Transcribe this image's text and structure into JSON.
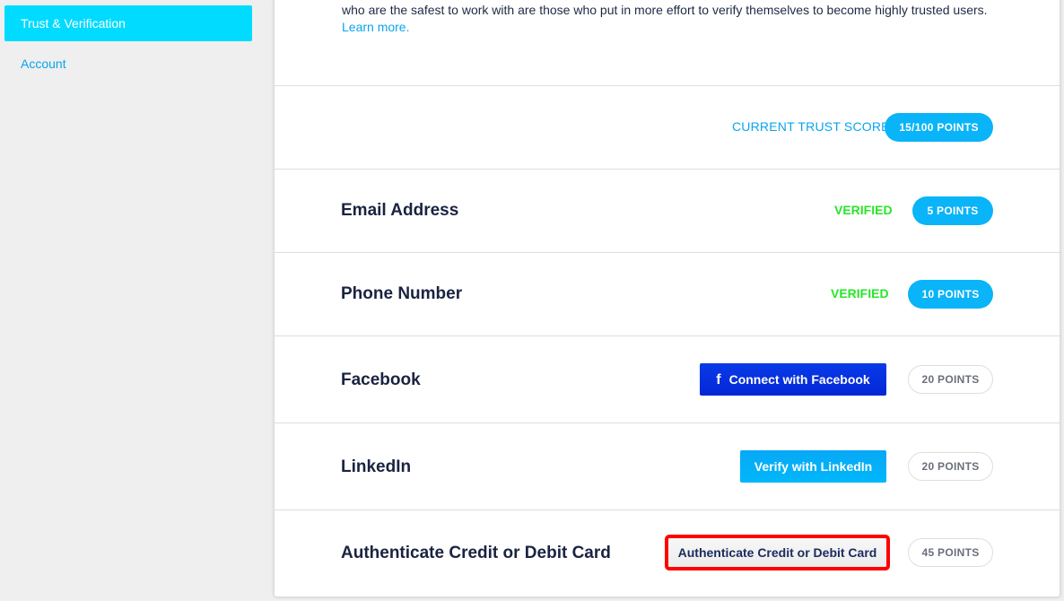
{
  "sidebar": {
    "items": [
      {
        "label": "Trust & Verification",
        "active": true
      },
      {
        "label": "Account",
        "active": false
      }
    ]
  },
  "intro": {
    "text": "who are the safest to work with are those who put in more effort to verify themselves to become highly trusted users.",
    "learn_more": "Learn more."
  },
  "trust_score": {
    "label": "CURRENT TRUST SCORE",
    "value": "15/100 POINTS"
  },
  "verifications": [
    {
      "title": "Email Address",
      "status": "VERIFIED",
      "points": "5 POINTS"
    },
    {
      "title": "Phone Number",
      "status": "VERIFIED",
      "points": "10 POINTS"
    },
    {
      "title": "Facebook",
      "action": "Connect with Facebook",
      "points": "20 POINTS"
    },
    {
      "title": "LinkedIn",
      "action": "Verify with LinkedIn",
      "points": "20 POINTS"
    },
    {
      "title": "Authenticate Credit or Debit Card",
      "action": "Authenticate Credit or Debit Card",
      "points": "45 POINTS"
    }
  ],
  "colors": {
    "accent": "#00dbff",
    "link": "#0aa4ee",
    "verified": "#27e627",
    "facebook": "#0a3ae8",
    "linkedin": "#00b7fb",
    "highlight": "#ff0000"
  }
}
